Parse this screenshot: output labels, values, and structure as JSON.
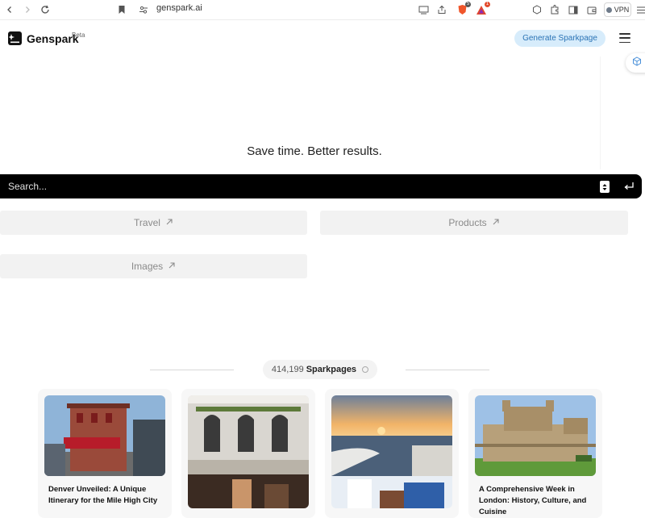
{
  "browser": {
    "url": "genspark.ai",
    "brave_badge": "5",
    "rewards_badge": "1",
    "vpn_label": "VPN"
  },
  "header": {
    "logo_text": "Genspark",
    "beta": "Beta",
    "generate_button": "Generate Sparkpage"
  },
  "hero": {
    "tagline": "Save time. Better results.",
    "search_placeholder": "Search..."
  },
  "chips": [
    {
      "label": "Travel",
      "icon": "arrow-up-right-icon"
    },
    {
      "label": "Products",
      "icon": "arrow-up-right-icon"
    },
    {
      "label": "Images",
      "icon": "arrow-up-right-icon"
    }
  ],
  "sparkpages": {
    "count": "414,199",
    "label": "Sparkpages"
  },
  "cards": [
    {
      "title": "Denver Unveiled: A Unique Itinerary for the Mile High City"
    },
    {
      "title": ""
    },
    {
      "title": ""
    },
    {
      "title": "A Comprehensive Week in London: History, Culture, and Cuisine"
    }
  ],
  "colors": {
    "accent_button_bg": "#d7ecfb",
    "accent_button_text": "#2a73b5",
    "search_bg": "#000000"
  }
}
